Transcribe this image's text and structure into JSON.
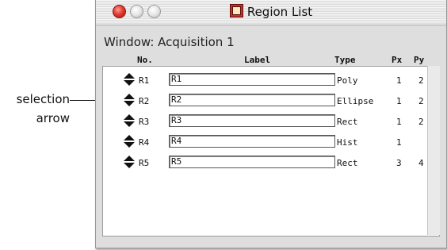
{
  "callout": {
    "line1": "selection",
    "line2": "arrow"
  },
  "window": {
    "title": "Region List",
    "window_label": "Window: Acquisition 1"
  },
  "columns": {
    "no": "No.",
    "label": "Label",
    "type": "Type",
    "px": "Px",
    "py": "Py"
  },
  "rows": [
    {
      "no": "R1",
      "label": "R1",
      "type": "Poly",
      "px": "1",
      "py": "2"
    },
    {
      "no": "R2",
      "label": "R2",
      "type": "Ellipse",
      "px": "1",
      "py": "2"
    },
    {
      "no": "R3",
      "label": "R3",
      "type": "Rect",
      "px": "1",
      "py": "2"
    },
    {
      "no": "R4",
      "label": "R4",
      "type": "Hist",
      "px": "1",
      "py": ""
    },
    {
      "no": "R5",
      "label": "R5",
      "type": "Rect",
      "px": "3",
      "py": "4"
    }
  ]
}
